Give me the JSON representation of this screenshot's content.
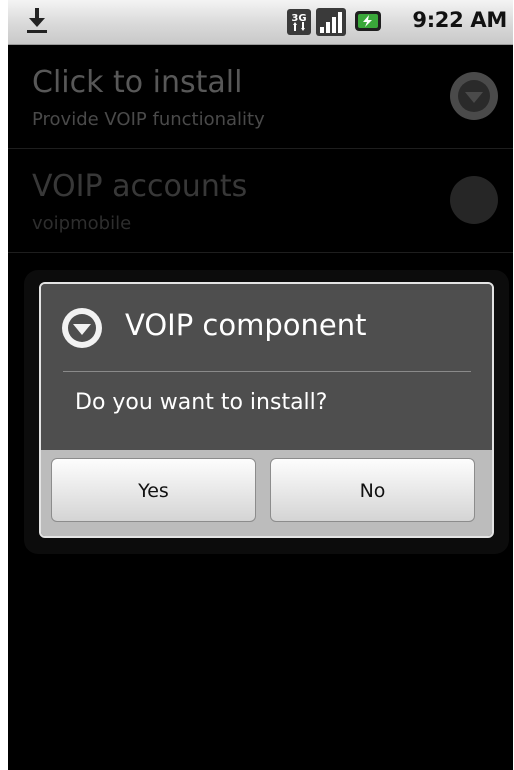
{
  "status_bar": {
    "time": "9:22 AM",
    "network_label": "3G",
    "icons": [
      "download-icon",
      "3g-icon",
      "signal-icon",
      "battery-charging-icon"
    ]
  },
  "settings_list": {
    "items": [
      {
        "title": "Click to install",
        "summary": "Provide VOIP functionality",
        "icon": "install-arrow-icon"
      },
      {
        "title": "VOIP accounts",
        "summary": "voipmobile",
        "icon": "round-icon"
      }
    ]
  },
  "dialog": {
    "title": "VOIP component",
    "icon": "dropdown-arrow-icon",
    "message": "Do you want to install?",
    "buttons": {
      "yes": "Yes",
      "no": "No"
    }
  },
  "colors": {
    "background": "#000000",
    "status_bar": "#d9d9d9",
    "dialog_body": "#4e4e4e",
    "dialog_button_bar": "#bcbcbc",
    "battery_accent": "#3aa83a"
  }
}
